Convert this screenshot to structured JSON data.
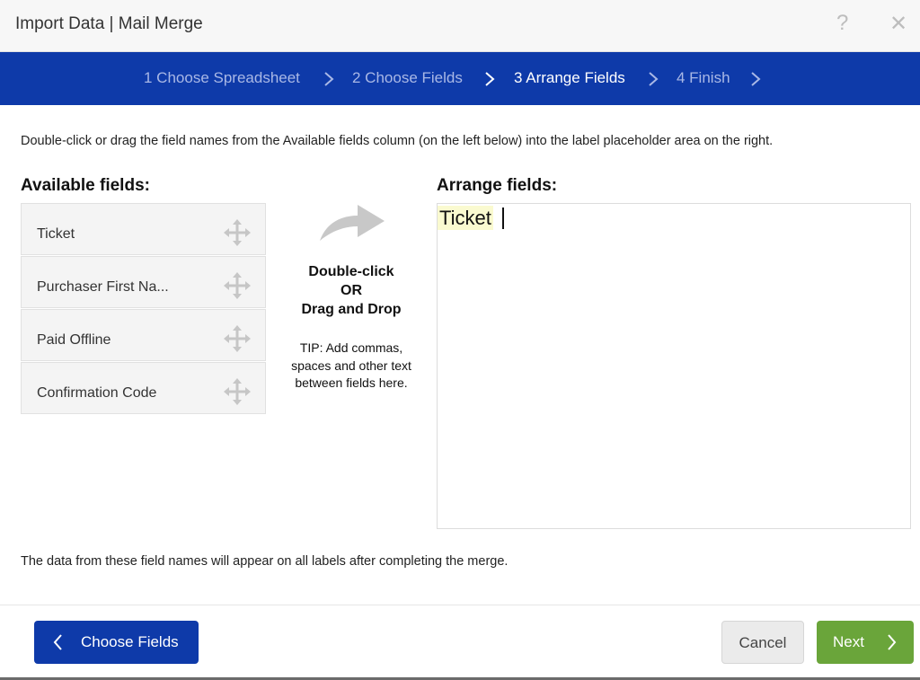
{
  "window": {
    "title": "Import Data | Mail Merge",
    "help_glyph": "?",
    "close_glyph": "✕"
  },
  "steps": [
    {
      "label": "1 Choose Spreadsheet",
      "active": false
    },
    {
      "label": "2 Choose Fields",
      "active": false
    },
    {
      "label": "3 Arrange Fields",
      "active": true
    },
    {
      "label": "4 Finish",
      "active": false
    }
  ],
  "instructions": "Double-click or drag the field names from the Available fields column (on the left below) into the label placeholder area on the right.",
  "available": {
    "heading": "Available fields:",
    "fields": [
      "Ticket",
      "Purchaser First Na...",
      "Paid Offline",
      "Confirmation Code"
    ]
  },
  "middle": {
    "line1": "Double-click",
    "line2": "OR",
    "line3": "Drag and Drop",
    "tip1": "TIP: Add commas,",
    "tip2": "spaces and other text",
    "tip3": "between fields here."
  },
  "arrange": {
    "heading": "Arrange fields:",
    "tokens": [
      "Ticket"
    ]
  },
  "footer_note": "The data from these field names will appear on all labels after completing the merge.",
  "buttons": {
    "back": "Choose Fields",
    "cancel": "Cancel",
    "next": "Next"
  },
  "colors": {
    "brand_blue": "#0e3aa9",
    "next_green": "#6aa53a",
    "token_highlight": "#fafad0"
  }
}
